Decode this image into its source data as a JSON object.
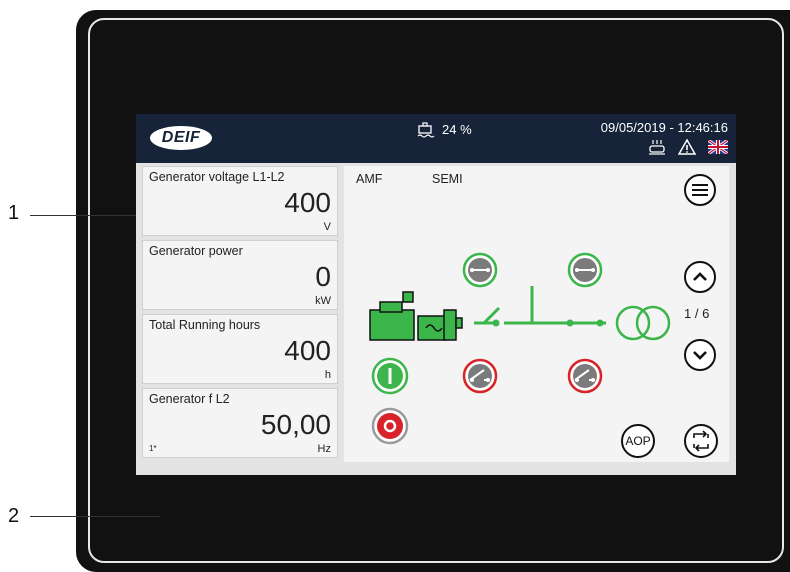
{
  "callouts": [
    {
      "label": "1"
    },
    {
      "label": "2"
    }
  ],
  "topbar": {
    "logo_text": "DEIF",
    "fuel_level": "24 %",
    "datetime": "09/05/2019 - 12:46:16",
    "icons": [
      "fuel-tank-icon",
      "heater-icon",
      "warning-icon",
      "uk-flag-icon"
    ]
  },
  "measurements": [
    {
      "label": "Generator voltage L1-L2",
      "value": "400",
      "unit": "V",
      "note": ""
    },
    {
      "label": "Generator power",
      "value": "0",
      "unit": "kW",
      "note": ""
    },
    {
      "label": "Total Running hours",
      "value": "400",
      "unit": "h",
      "note": ""
    },
    {
      "label": "Generator f L2",
      "value": "50,00",
      "unit": "Hz",
      "note": "1*"
    }
  ],
  "diagram": {
    "mode_1": "AMF",
    "mode_2": "SEMI",
    "page_indicator": "1 / 6",
    "aop_label": "AOP"
  },
  "colors": {
    "topbar": "#162338",
    "green": "#3cb54a",
    "red": "#d8232a",
    "breaker_gray": "#7b7b7b"
  }
}
